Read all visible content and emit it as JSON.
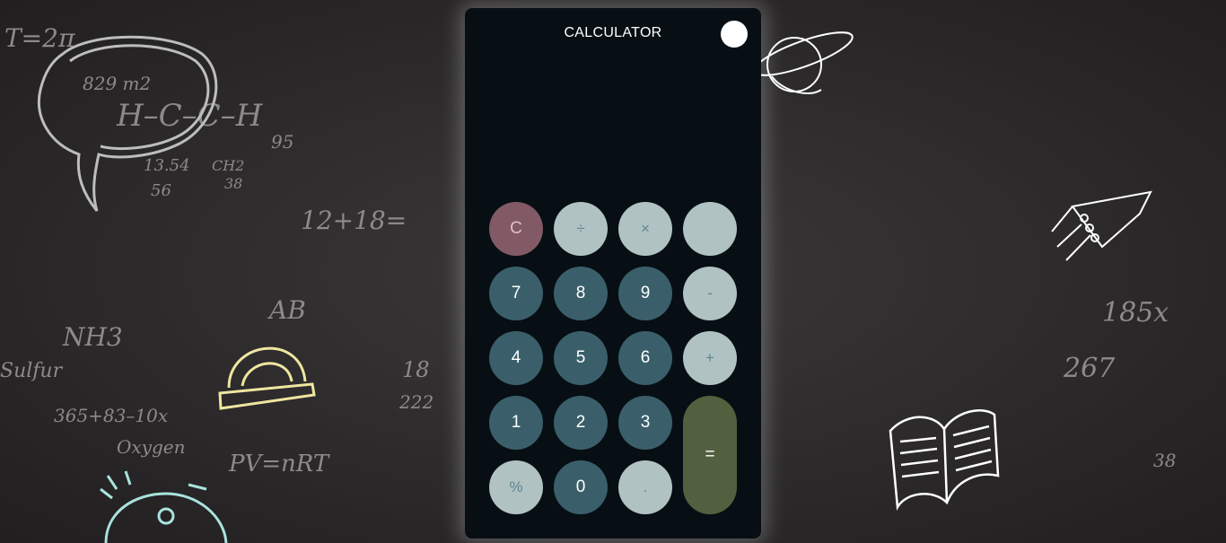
{
  "app": {
    "title": "CALCULATOR",
    "display_value": ""
  },
  "colors": {
    "background": "#2a2829",
    "calculator_body": "#070f14",
    "number_key": "#3a5f6b",
    "operator_key": "#b0c2c2",
    "clear_key": "#825a66",
    "equals_key": "#52603f",
    "toggle": "#ffffff"
  },
  "keys": {
    "clear": "C",
    "divide": "÷",
    "multiply": "×",
    "blank": "",
    "seven": "7",
    "eight": "8",
    "nine": "9",
    "minus": "-",
    "four": "4",
    "five": "5",
    "six": "6",
    "plus": "+",
    "one": "1",
    "two": "2",
    "three": "3",
    "equals": "=",
    "percent": "%",
    "zero": "0",
    "decimal": "."
  },
  "background_doodles": {
    "chalk_text": [
      "T=2π",
      "H–C–C–H",
      "829 m2",
      "95",
      "13.54",
      "56",
      "CH2",
      "38",
      "12+18=",
      "NH3",
      "365+83–10x",
      "Oxygen",
      "PV=nRT",
      "AB",
      "18",
      "222",
      "267",
      "185x",
      "38",
      "Sulfur"
    ],
    "icons": [
      "speech-bubble-icon",
      "planet-icon",
      "rocket-icon",
      "protractor-icon",
      "open-book-icon",
      "alarm-clock-icon"
    ]
  }
}
